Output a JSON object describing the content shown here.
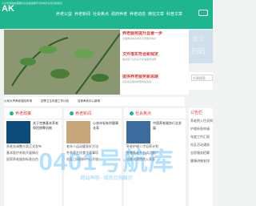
{
  "header": {
    "top_note": "公众号/微信前需要关注的健康细节与时尚养生知识库频道",
    "logo": "AK",
    "nav": [
      "养老公益",
      "养老新闻",
      "社会焦点",
      "政府养老",
      "养老动态",
      "微信文章",
      "科普文章"
    ]
  },
  "hero_side": [
    {
      "title": "养老服务提升显著一步",
      "text": "全面推进改善城乡养老服务体系"
    },
    {
      "title": "文件落实符合新规定",
      "text": "相关部门主管关于补贴事项说明"
    },
    {
      "title": "提供养老服务新思路",
      "text": "社区站点服务质量持续改进"
    }
  ],
  "ad1": {
    "t1": "泰安",
    "t2": "扫码"
  },
  "ad2": {
    "label": "文章搜索"
  },
  "ticker": [
    "九旬大爷养老保险申请",
    "四季卫生年度工作计划",
    "百家养老中心新闻"
  ],
  "columns": [
    {
      "cat": "养老政策",
      "title": "关于完善基本养老保险统筹机制",
      "lines": [
        "养老金调整方案正式发布",
        "基本医疗补助开展情况",
        "居家养老服务标准出台"
      ]
    },
    {
      "cat": "养老新闻",
      "title": "心态年轻有利健康长寿",
      "lines": [
        "老年人运动健身好方法",
        "冬季养生饮食注意事项",
        "社区日间照料中心开放"
      ]
    },
    {
      "cat": "社会焦点",
      "title": "中国养老服务行业发展",
      "lines": [
        "养老护理人才培养计划",
        "智慧养老平台试点推广",
        "适老化改造进入家庭"
      ]
    }
  ],
  "side2": {
    "head": "公告栏",
    "items": [
      "养老院入住须知",
      "护理补贴申请",
      "年度工作汇报",
      "社区活动通知",
      "志愿服务招募",
      "健康讲座安排"
    ]
  },
  "watermark": {
    "main": "0401号航库",
    "sub": "网站声明 · 域名仅供展示"
  }
}
